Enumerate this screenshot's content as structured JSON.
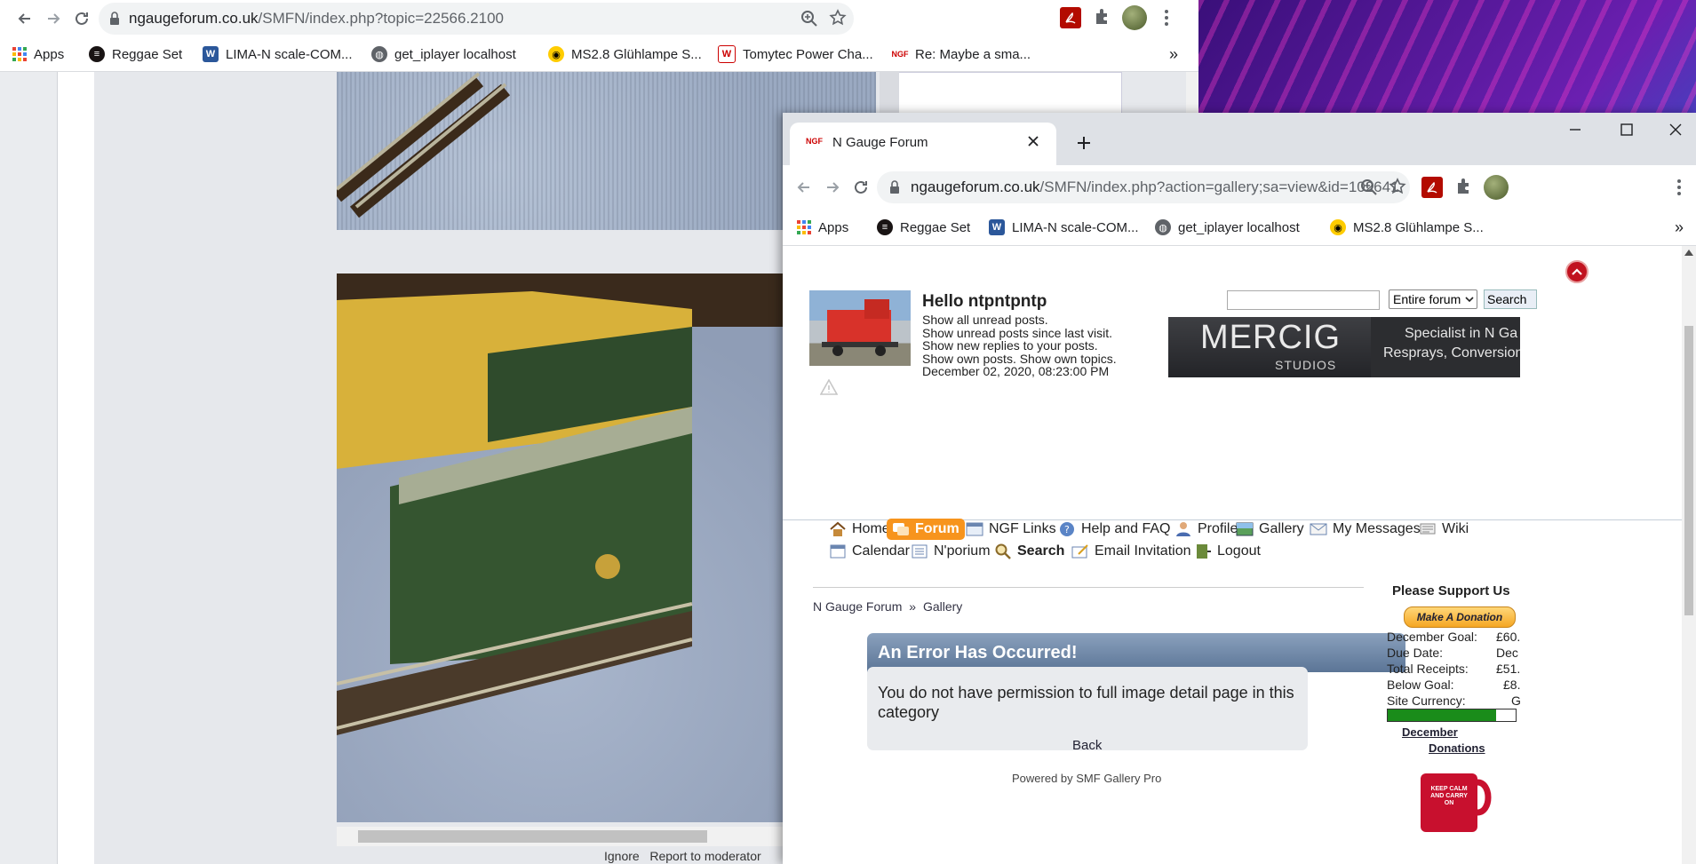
{
  "back_window": {
    "url_host": "ngaugeforum.co.uk",
    "url_path": "/SMFN/index.php?topic=22566.2100",
    "bookmarks": [
      {
        "label": "Apps",
        "icon": "apps-grid-icon"
      },
      {
        "label": "Reggae Set",
        "icon": "spotify-icon"
      },
      {
        "label": "LIMA-N scale-COM...",
        "icon": "word-icon"
      },
      {
        "label": "get_iplayer localhost",
        "icon": "globe-icon"
      },
      {
        "label": "MS2.8 Glühlampe S...",
        "icon": "car-icon"
      },
      {
        "label": "Tomytec Power Cha...",
        "icon": "w-icon"
      },
      {
        "label": "Re: Maybe a sma...",
        "icon": "ngf-icon"
      }
    ],
    "bookmarks_overflow": "»",
    "footer_links": "Ignore   Report to moderator"
  },
  "front_window": {
    "tab_title": "N Gauge Forum",
    "tab_favicon": "NGF",
    "url_host": "ngaugeforum.co.uk",
    "url_path": "/SMFN/index.php?action=gallery;sa=view&id=102641",
    "bookmarks": [
      {
        "label": "Apps",
        "icon": "apps-grid-icon"
      },
      {
        "label": "Reggae Set",
        "icon": "spotify-icon"
      },
      {
        "label": "LIMA-N scale-COM...",
        "icon": "word-icon"
      },
      {
        "label": "get_iplayer localhost",
        "icon": "globe-icon"
      },
      {
        "label": "MS2.8 Glühlampe S...",
        "icon": "car-icon"
      }
    ],
    "bookmarks_overflow": "»"
  },
  "forum": {
    "greeting": "Hello ntpntpntp",
    "user_links": [
      "Show all unread posts.",
      "Show unread posts since last visit.",
      "Show new replies to your posts.",
      "Show own posts. Show own topics."
    ],
    "datetime": "December 02, 2020, 08:23:00 PM",
    "search_placeholder": "",
    "search_scope": "Entire forum",
    "search_button": "Search",
    "banner_brand": "MERCIG",
    "banner_sub": "STUDIOS",
    "banner_text1": "Specialist in N Ga",
    "banner_text2": "Resprays, Conversion",
    "menu_row1": [
      {
        "label": "Home",
        "icon": "home-icon"
      },
      {
        "label": "Forum",
        "icon": "forum-icon",
        "active": true
      },
      {
        "label": "NGF Links",
        "icon": "links-icon"
      },
      {
        "label": "Help and FAQ",
        "icon": "help-icon"
      },
      {
        "label": "Profile",
        "icon": "profile-icon"
      },
      {
        "label": "Gallery",
        "icon": "gallery-icon"
      },
      {
        "label": "My Messages",
        "icon": "messages-icon"
      },
      {
        "label": "Wiki",
        "icon": "wiki-icon"
      }
    ],
    "menu_row2": [
      {
        "label": "Calendar",
        "icon": "calendar-icon"
      },
      {
        "label": "N'porium",
        "icon": "nporium-icon"
      },
      {
        "label": "Search",
        "icon": "search-icon",
        "bold": true
      },
      {
        "label": "Email Invitation",
        "icon": "email-icon"
      },
      {
        "label": "Logout",
        "icon": "logout-icon"
      }
    ],
    "breadcrumb": [
      "N Gauge Forum",
      "Gallery"
    ],
    "breadcrumb_sep": "»",
    "error_title": "An Error Has Occurred!",
    "error_message": "You do not have permission to full image detail page in this category",
    "back_link": "Back",
    "powered_by": "Powered by SMF Gallery Pro",
    "support_title": "Please Support Us",
    "donate_button": "Make A Donation",
    "donations": [
      {
        "label": "December Goal:",
        "value": "£60."
      },
      {
        "label": "Due Date:",
        "value": "Dec"
      },
      {
        "label": "Total Receipts:",
        "value": "£51."
      },
      {
        "label": "Below Goal:",
        "value": "£8."
      },
      {
        "label": "Site Currency:",
        "value": "G"
      }
    ],
    "progress_percent": 85,
    "progress_label": "85%",
    "donations_link_1": "December",
    "donations_link_2": "Donations",
    "mug_text": "KEEP CALM AND CARRY ON"
  },
  "colors": {
    "error_header": "#6f88a8",
    "menu_active": "#f7941d",
    "progress": "#1a8c1a"
  }
}
